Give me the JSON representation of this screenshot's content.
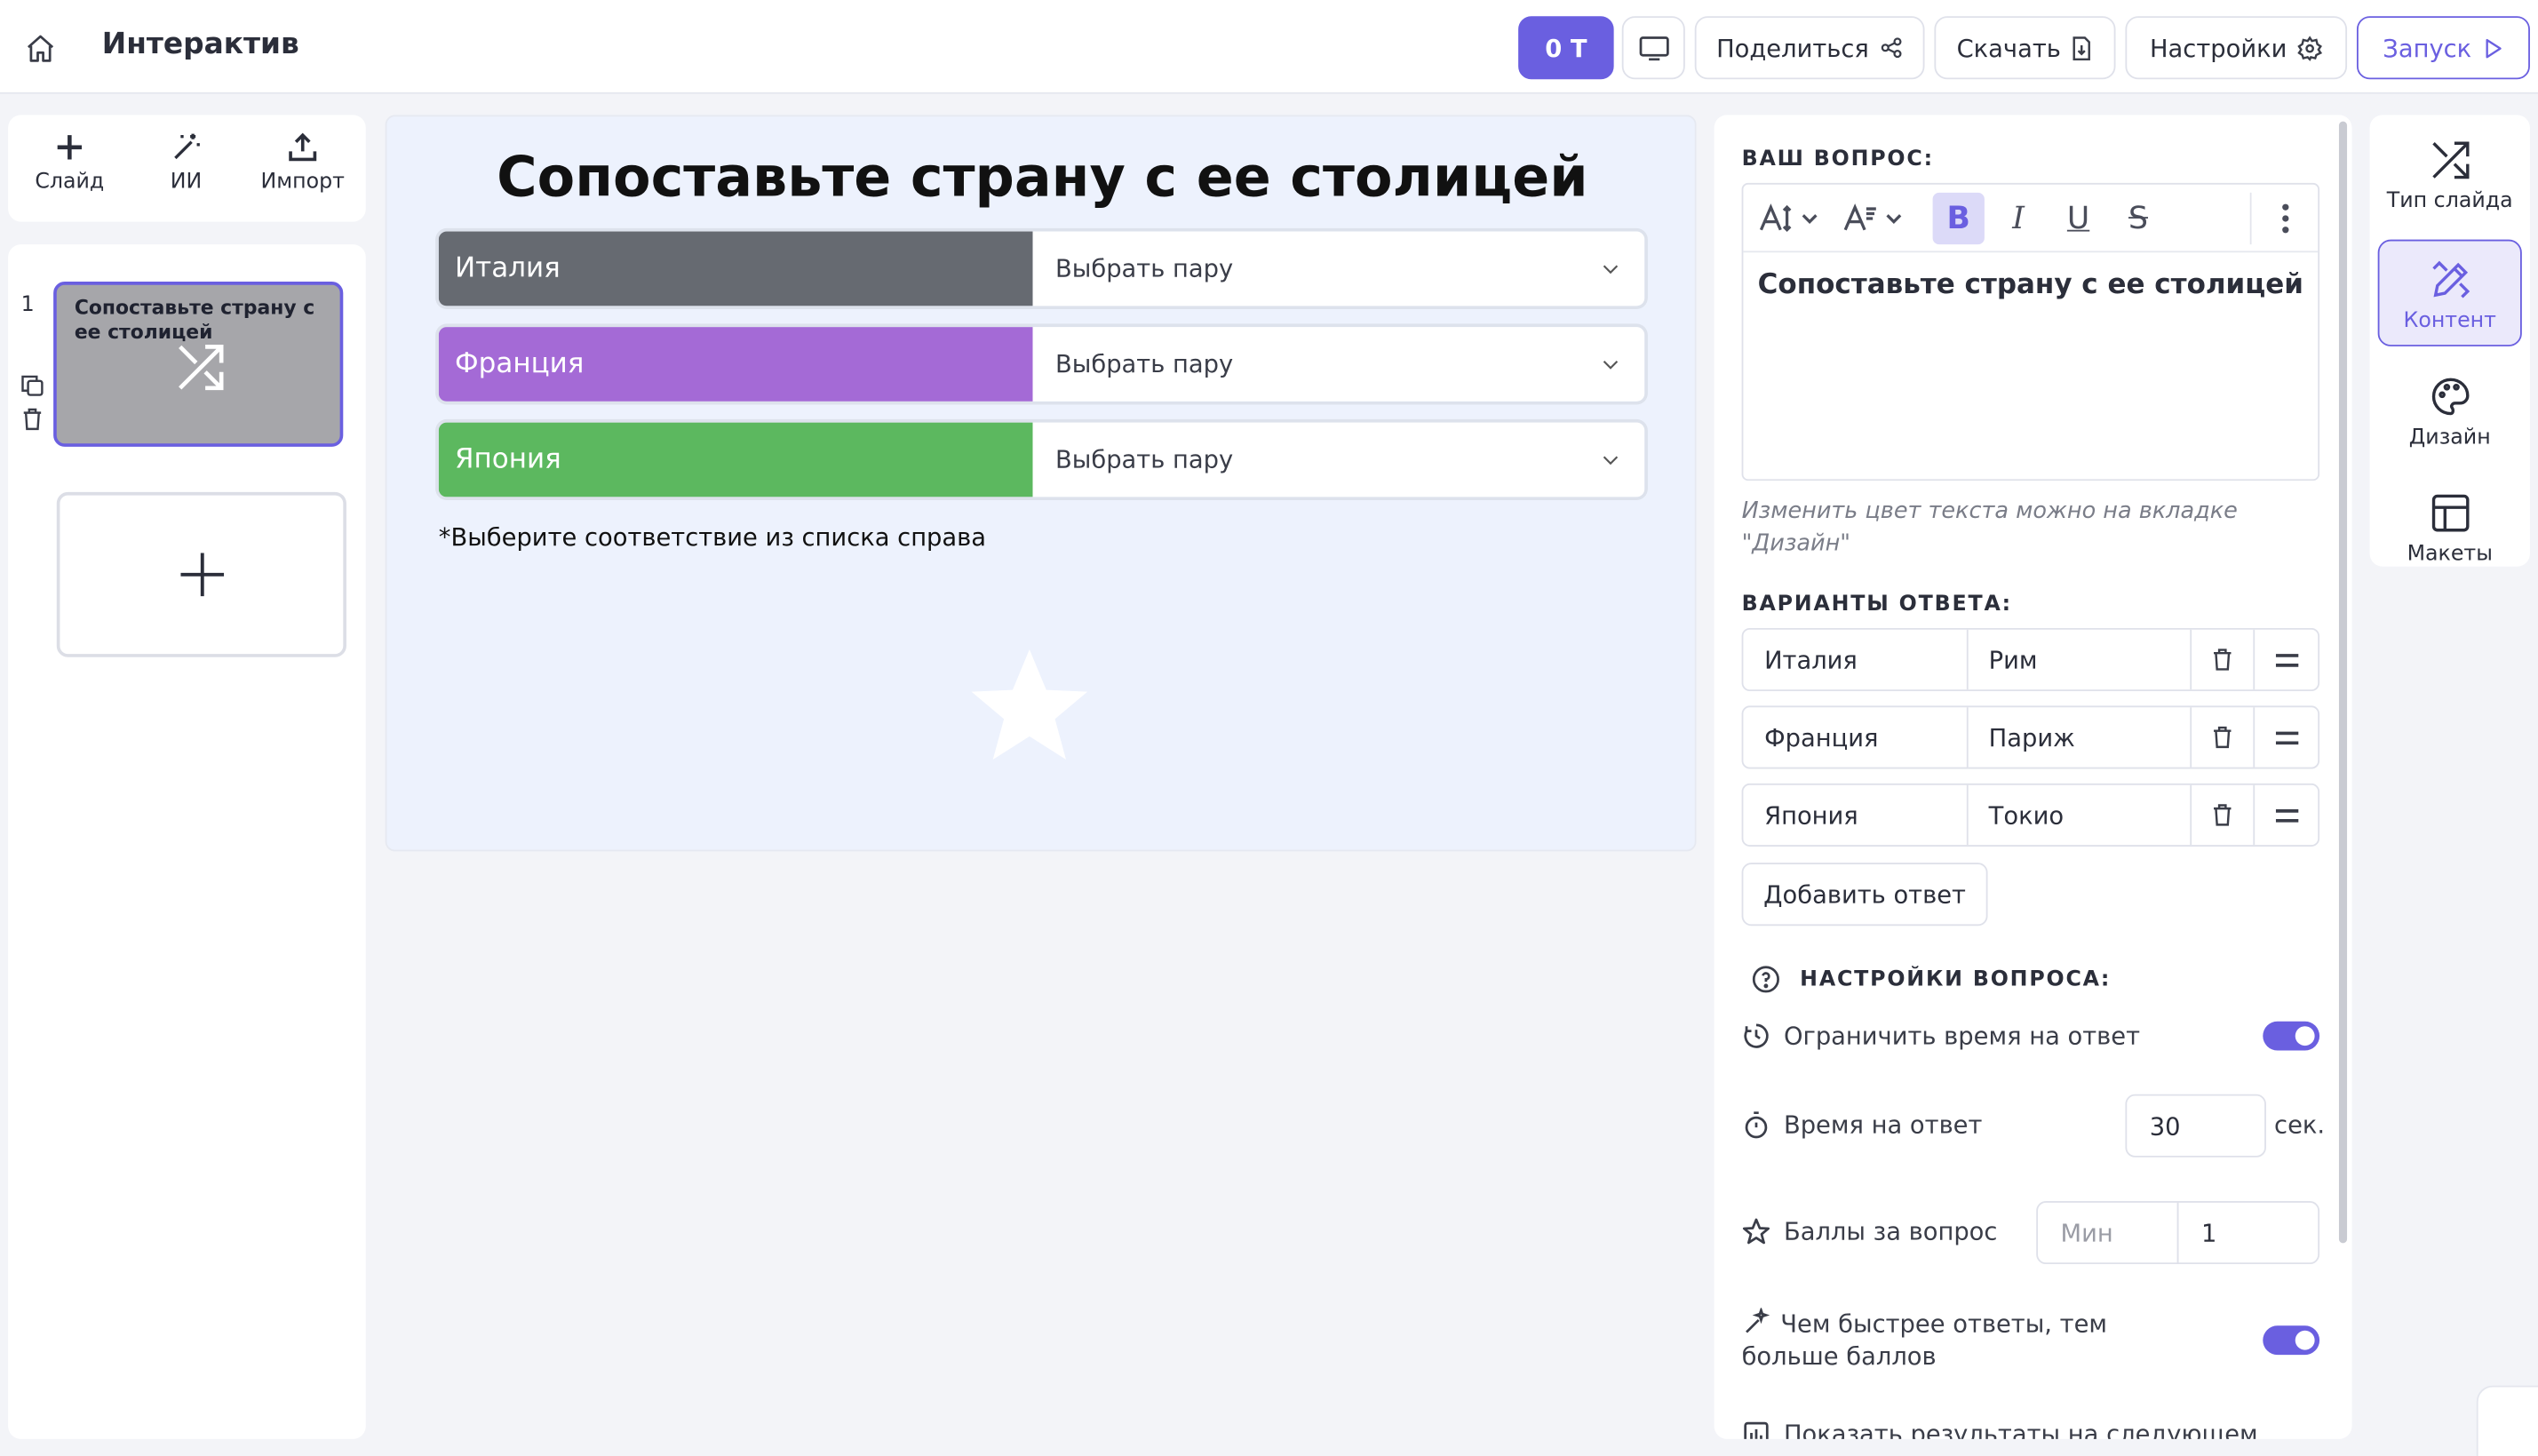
{
  "header": {
    "app_title": "Интерактив",
    "points_label": "0 Т",
    "share_label": "Поделиться",
    "download_label": "Скачать",
    "settings_label": "Настройки",
    "launch_label": "Запуск"
  },
  "left_tools": {
    "slide_label": "Слайд",
    "ai_label": "ИИ",
    "import_label": "Импорт"
  },
  "slides": {
    "items": [
      {
        "number": "1",
        "title": "Сопоставьте страну с ее столицей"
      }
    ]
  },
  "canvas": {
    "title": "Сопоставьте страну с ее столицей",
    "pairs": [
      {
        "left": "Италия",
        "right_placeholder": "Выбрать пару",
        "color": "#666a71"
      },
      {
        "left": "Франция",
        "right_placeholder": "Выбрать пару",
        "color": "#a46ad6"
      },
      {
        "left": "Япония",
        "right_placeholder": "Выбрать пару",
        "color": "#5cb85f"
      }
    ],
    "hint": "*Выберите соответствие из списка справа"
  },
  "editor": {
    "question_label": "ВАШ ВОПРОС:",
    "question_text": "Сопоставьте страну с ее столицей",
    "note": "Изменить цвет текста можно на вкладке \"Дизайн\"",
    "answers_label": "ВАРИАНТЫ ОТВЕТА:",
    "answers": [
      {
        "a": "Италия",
        "b": "Рим"
      },
      {
        "a": "Франция",
        "b": "Париж"
      },
      {
        "a": "Япония",
        "b": "Токио"
      }
    ],
    "add_answer_label": "Добавить ответ",
    "settings_label": "НАСТРОЙКИ ВОПРОСА:",
    "limit_time_label": "Ограничить время на ответ",
    "limit_time_on": true,
    "time_label": "Время на ответ",
    "time_value": "30",
    "time_unit": "сек.",
    "points_label": "Баллы за вопрос",
    "points_min_placeholder": "Мин",
    "points_value": "1",
    "faster_label": "Чем быстрее ответы, тем больше баллов",
    "faster_on": true,
    "show_results_label": "Показать результаты на следующем"
  },
  "side_tabs": {
    "slide_type": "Тип слайда",
    "content": "Контент",
    "design": "Дизайн",
    "layouts": "Макеты"
  },
  "colors": {
    "accent": "#6a5fe0"
  }
}
